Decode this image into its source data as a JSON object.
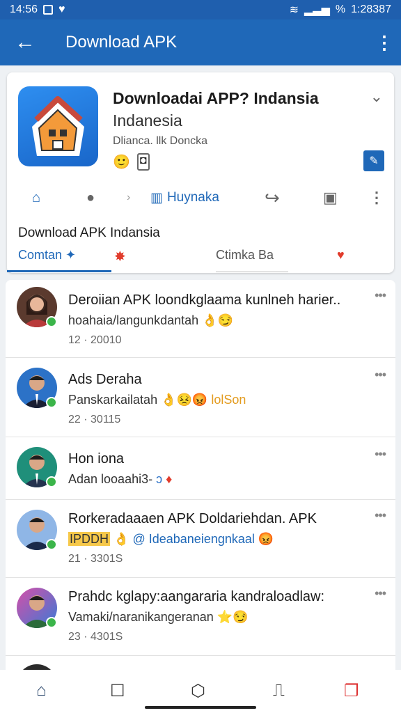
{
  "status_bar": {
    "time": "14:56",
    "battery_pct": "%",
    "right_text": "1:28387"
  },
  "appbar": {
    "title": "Download APK"
  },
  "app_card": {
    "name": "Downloadai APP? Indansia",
    "subtitle": "Indanesia",
    "developer": "Dlianca. llk Doncka",
    "tab_label": "Huynaka",
    "section_title": "Download APK Indansia",
    "tabs": [
      "Comtan",
      "Ctimka Ba"
    ]
  },
  "feed": [
    {
      "title": "Deroiian APK loondkglaama kunlneh harier..",
      "subtitle": "hoahaia/langunkdantah",
      "time": "12 · 20010"
    },
    {
      "title": "Ads Deraha",
      "subtitle": "Panskarkailatah",
      "extra": "lolSon",
      "time": "22 · 30115"
    },
    {
      "title": "Hon iona",
      "subtitle": "Adan looaahi3-",
      "time": ""
    },
    {
      "title": "Rorkeradaaaen APK Doldariehdan. APK",
      "subtitle_a": "IPDDH",
      "subtitle_b": "@ Ideabaneiengnkaal",
      "time": "21 · 3301S"
    },
    {
      "title": "Prahdc kglapy:aangararia kandraloadlaw:",
      "subtitle": "Vamaki/naranikangeranan",
      "time": "23 · 4301S"
    }
  ],
  "colors": {
    "primary": "#1f68b8",
    "status_bar": "#1f5fae",
    "online": "#3bb54a",
    "accent_red": "#e13c2c"
  }
}
